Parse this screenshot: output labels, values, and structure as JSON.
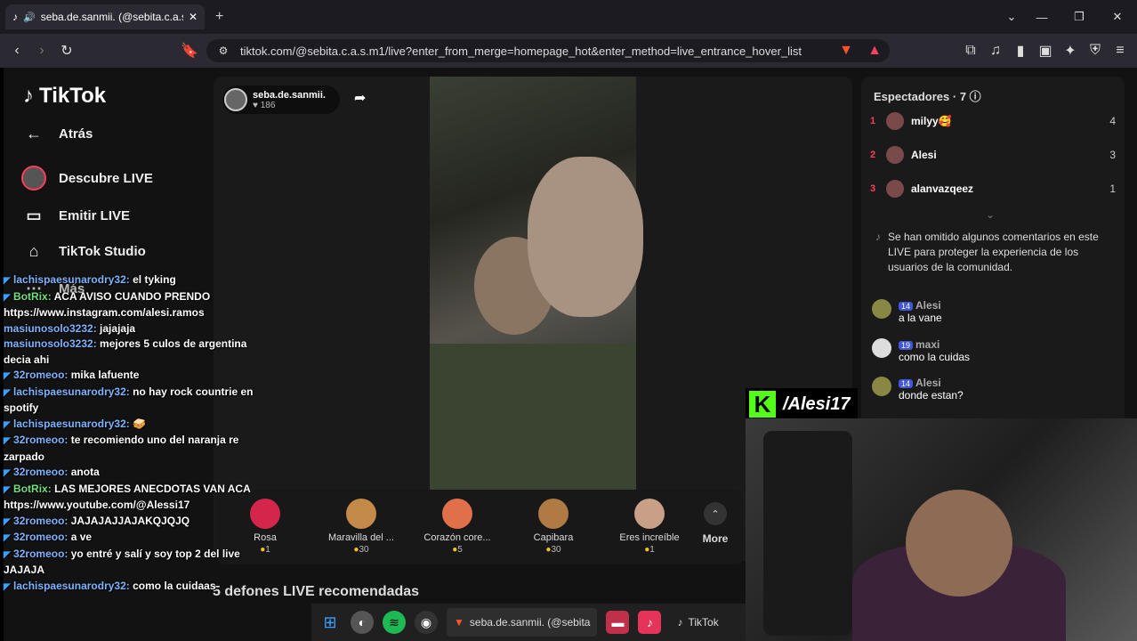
{
  "browser": {
    "tab_title": "seba.de.sanmii. (@sebita.c.a.s",
    "url": "tiktok.com/@sebita.c.a.s.m1/live?enter_from_merge=homepage_hot&enter_method=live_entrance_hover_list"
  },
  "sidebar": {
    "logo": "TikTok",
    "items": [
      {
        "label": "Atrás",
        "icon": "arrow-left-icon"
      },
      {
        "label": "Descubre LIVE",
        "icon": "live-avatar-icon"
      },
      {
        "label": "Emitir LIVE",
        "icon": "video-camera-icon"
      },
      {
        "label": "TikTok Studio",
        "icon": "studio-icon"
      },
      {
        "label": "Más",
        "icon": "more-icon"
      }
    ]
  },
  "host": {
    "name": "seba.de.sanmii.",
    "likes": "186"
  },
  "gifts": [
    {
      "name": "Rosa",
      "price": "1",
      "color": "#d3264a"
    },
    {
      "name": "Maravilla del ...",
      "price": "30",
      "color": "#c48a4a"
    },
    {
      "name": "Corazón core...",
      "price": "5",
      "color": "#e0704a"
    },
    {
      "name": "Capibara",
      "price": "30",
      "color": "#b07a45"
    },
    {
      "name": "Eres increíble",
      "price": "1",
      "color": "#c8a088"
    }
  ],
  "gifts_more": "More",
  "recommendations_title": "5 defones LIVE recomendadas",
  "viewers": {
    "title": "Espectadores · 7",
    "list": [
      {
        "rank": "1",
        "name": "milyy🥰",
        "score": "4"
      },
      {
        "rank": "2",
        "name": "Alesi",
        "score": "3"
      },
      {
        "rank": "3",
        "name": "alanvazqeez",
        "score": "1"
      }
    ]
  },
  "notice": "Se han omitido algunos comentarios en este LIVE para proteger la experiencia de los usuarios de la comunidad.",
  "comments": [
    {
      "badge": "14",
      "user": "Alesi",
      "text": "a la vane"
    },
    {
      "badge": "19",
      "user": "maxi",
      "text": "como la cuidas"
    },
    {
      "badge": "14",
      "user": "Alesi",
      "text": "donde estan?"
    }
  ],
  "chat": [
    {
      "user": "lachispaesunarodry32:",
      "text": "el tyking"
    },
    {
      "user": "BotRix:",
      "text": "ACA AVISO CUANDO PRENDO https://www.instagram.com/alesi.ramos"
    },
    {
      "user": "masiunosolo3232:",
      "text": "jajajaja"
    },
    {
      "user": "masiunosolo3232:",
      "text": "mejores 5 culos de argentina decia ahi"
    },
    {
      "user": "32romeoo:",
      "text": "mika lafuente"
    },
    {
      "user": "lachispaesunarodry32:",
      "text": "no hay rock countrie en spotify"
    },
    {
      "user": "lachispaesunarodry32:",
      "text": "🥪"
    },
    {
      "user": "32romeoo:",
      "text": "te recomiendo uno del naranja re zarpado"
    },
    {
      "user": "32romeoo:",
      "text": "anota"
    },
    {
      "user": "BotRix:",
      "text": "LAS MEJORES ANECDOTAS VAN ACA https://www.youtube.com/@Alessi17"
    },
    {
      "user": "32romeoo:",
      "text": "JAJAJAJJAJAKQJQJQ"
    },
    {
      "user": "32romeoo:",
      "text": "a ve"
    },
    {
      "user": "32romeoo:",
      "text": "yo entré y salí y soy top 2 del live JAJAJA"
    },
    {
      "user": "lachispaesunarodry32:",
      "text": "como la cuidaas"
    }
  ],
  "kick_label": "/Alesi17",
  "taskbar": {
    "app1": "seba.de.sanmii. (@sebita",
    "app2": "TikTok"
  }
}
